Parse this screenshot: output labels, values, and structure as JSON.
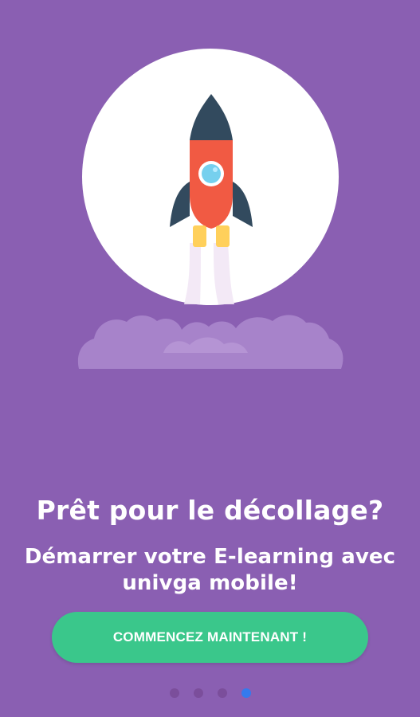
{
  "onboarding": {
    "title": "Prêt pour le décollage?",
    "subtitle": "Démarrer votre E-learning avec univga mobile!",
    "cta_label": "COMMENCEZ MAINTENANT !",
    "illustration_icon": "rocket-icon",
    "dots": [
      {
        "name": "page-dot-1",
        "active": false
      },
      {
        "name": "page-dot-2",
        "active": false
      },
      {
        "name": "page-dot-3",
        "active": false
      },
      {
        "name": "page-dot-4",
        "active": true
      }
    ]
  },
  "colors": {
    "background": "#8a5fb2",
    "button": "#3ac78b",
    "active_dot": "#2f7bf0",
    "inactive_dot": "#7a4d9a",
    "circle": "#ffffff",
    "rocket_body": "#f15a43",
    "rocket_dark": "#324a5e",
    "window": "#76d0ee",
    "flame": "#ffd05b",
    "cloud": "#a783ca"
  }
}
